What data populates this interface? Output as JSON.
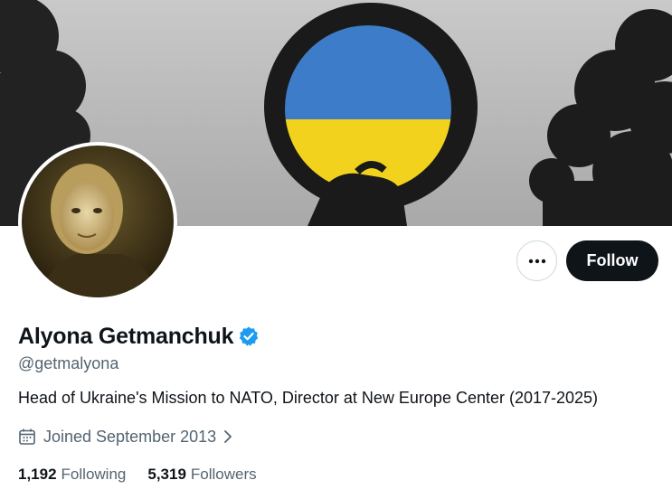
{
  "profile": {
    "display_name": "Alyona Getmanchuk",
    "handle": "@getmalyona",
    "bio": "Head of Ukraine's Mission to NATO, Director at New Europe Center (2017-2025)",
    "joined": "Joined September 2013",
    "following_count": "1,192",
    "following_label": "Following",
    "followers_count": "5,319",
    "followers_label": "Followers",
    "verified": true
  },
  "actions": {
    "follow_label": "Follow",
    "more_icon": "more-horizontal-icon"
  },
  "icons": {
    "verified": "verified-badge-icon",
    "calendar": "calendar-icon",
    "chevron": "chevron-right-icon"
  },
  "colors": {
    "text_primary": "#0f1419",
    "text_secondary": "#536471",
    "follow_bg": "#0f1419",
    "verified_blue": "#1d9bf0",
    "flag_blue": "#3d7cc8",
    "flag_yellow": "#f2d21d"
  }
}
